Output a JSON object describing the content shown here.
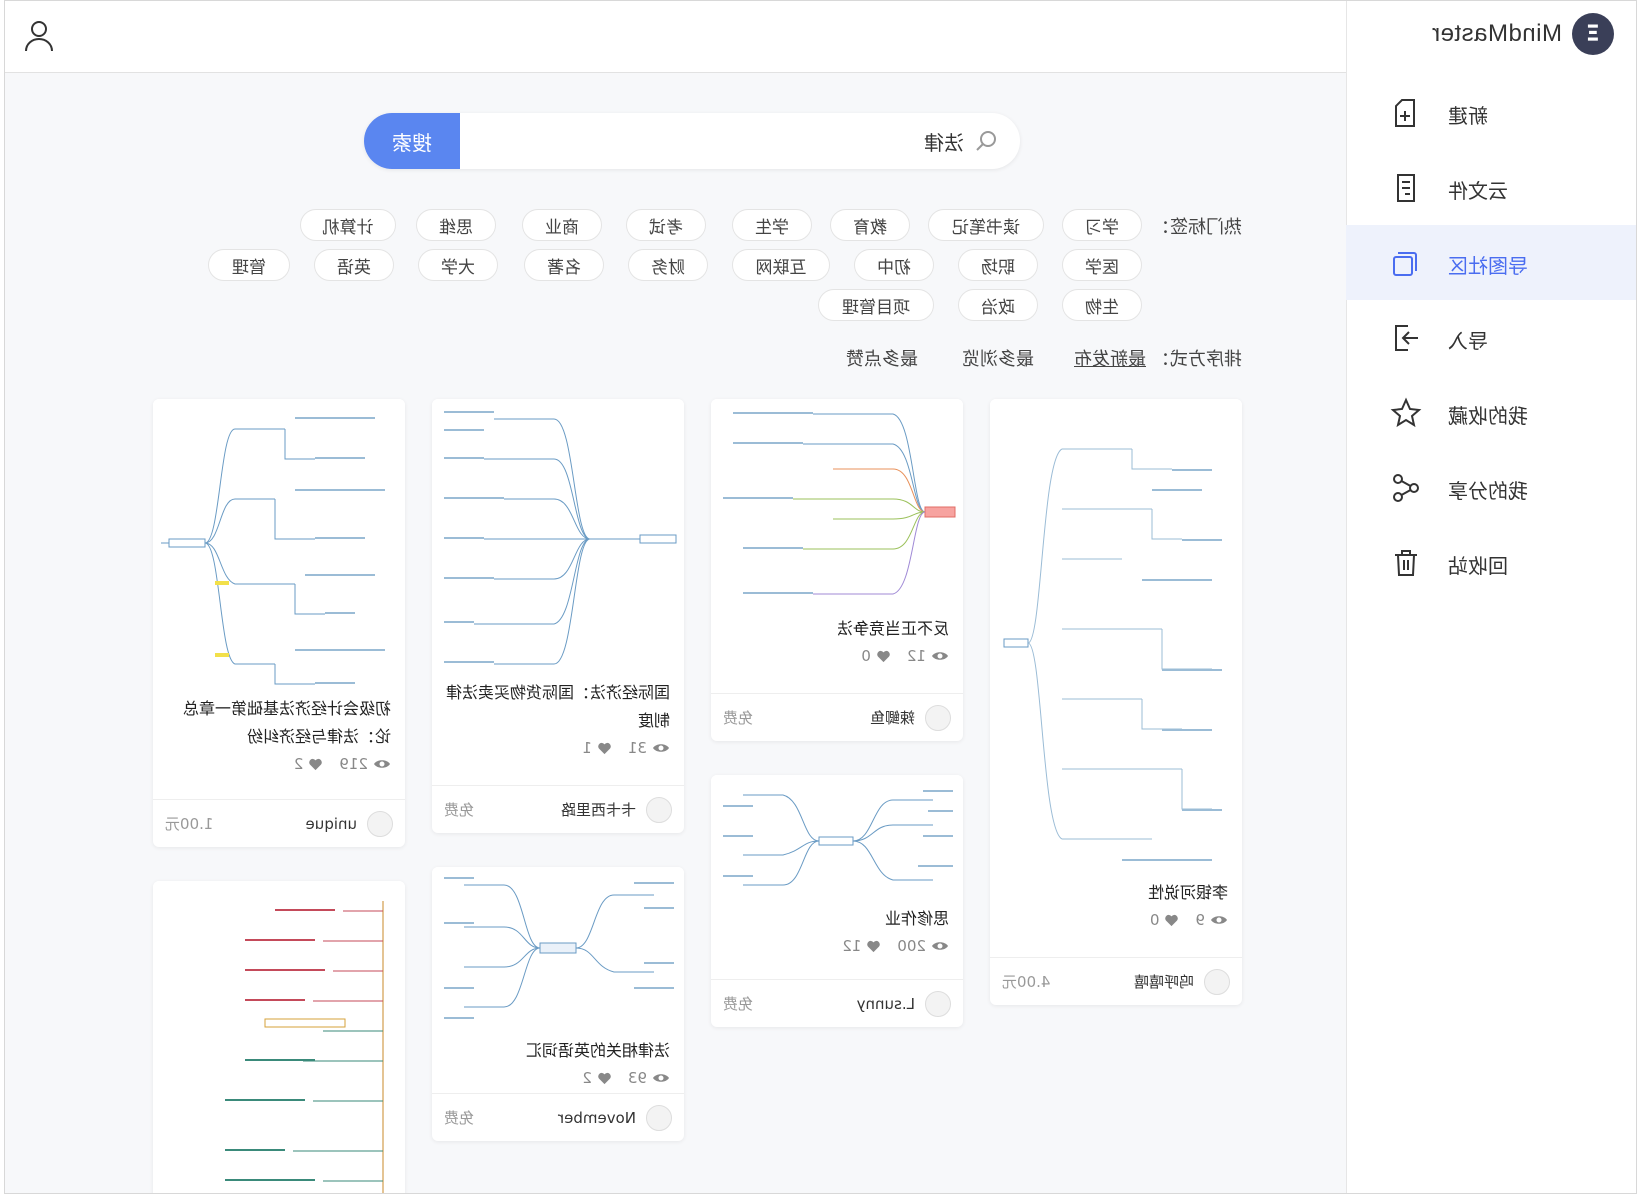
{
  "app": {
    "logo_text": "MindMaster"
  },
  "sidebar": {
    "items": [
      {
        "label": "新建",
        "icon": "new-file-icon",
        "active": false
      },
      {
        "label": "云文件",
        "icon": "cloud-file-icon",
        "active": false
      },
      {
        "label": "导图社区",
        "icon": "community-icon",
        "active": true
      },
      {
        "label": "导入",
        "icon": "import-icon",
        "active": false
      },
      {
        "label": "我的收藏",
        "icon": "star-icon",
        "active": false
      },
      {
        "label": "我的分享",
        "icon": "share-icon",
        "active": false
      },
      {
        "label": "回收站",
        "icon": "trash-icon",
        "active": false
      }
    ]
  },
  "search": {
    "value": "法律",
    "button_label": "搜索"
  },
  "tags": {
    "label": "热门标签：",
    "rows": [
      [
        "学习",
        "读书笔记",
        "教育",
        "学生",
        "考试",
        "商业",
        "思维",
        "计算机"
      ],
      [
        "医学",
        "职场",
        "初中",
        "互联网",
        "财务",
        "名著",
        "大学",
        "英语",
        "管理"
      ],
      [
        "生物",
        "政治",
        "项目管理"
      ]
    ]
  },
  "sort": {
    "label": "排序方式：",
    "options": [
      "最新发布",
      "最多浏览",
      "最多点赞"
    ],
    "active": "最新发布"
  },
  "cards": [
    {
      "title": "李银河说性",
      "views": "9",
      "likes": "0",
      "author": "呜呼嘻嘻",
      "price": "4.00元"
    },
    {
      "title": "反不正当竞争法",
      "views": "12",
      "likes": "0",
      "author": "辣鲫鱼",
      "price": "免费"
    },
    {
      "title": "思修作业",
      "views": "200",
      "likes": "12",
      "author": "L.sunny",
      "price": "免费"
    },
    {
      "title": "国际经济法：国际货物买卖法律制度",
      "views": "31",
      "likes": "1",
      "author": "卡卡西里路",
      "price": "免费"
    },
    {
      "title": "法律相关的英语词汇",
      "views": "93",
      "likes": "2",
      "author": "November",
      "price": "免费"
    },
    {
      "title": "初级会计经济法基础第一章总论：法律与经济纠纷",
      "views": "219",
      "likes": "2",
      "author": "unique",
      "price": "1.00元"
    },
    {
      "title": "",
      "views": "",
      "likes": "",
      "author": "",
      "price": ""
    }
  ],
  "colors": {
    "accent": "#5a86f0",
    "active_bg": "#eef2fc",
    "active_text": "#4a6df0"
  }
}
